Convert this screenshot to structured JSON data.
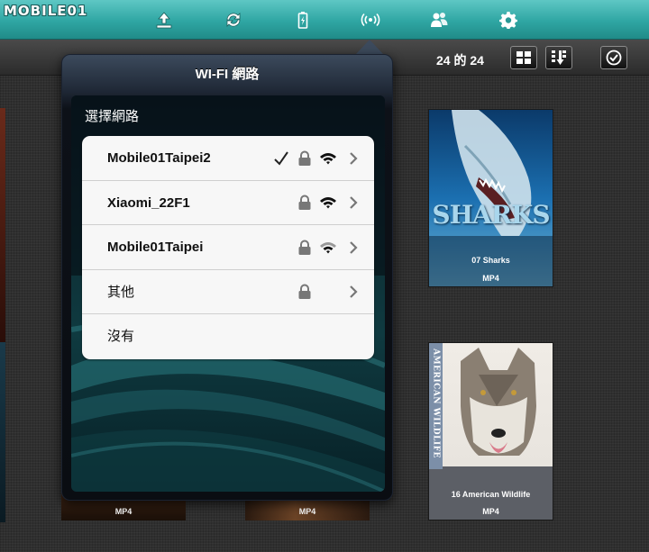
{
  "app": {
    "logo": "MOBILE01"
  },
  "toolbar": {
    "icons": [
      "upload-icon",
      "sync-icon",
      "battery-icon",
      "wifi-broadcast-icon",
      "users-icon",
      "gear-icon"
    ]
  },
  "subbar": {
    "count_text": "24 的 24"
  },
  "wifi_popover": {
    "title": "WI-FI 網路",
    "section_header": "選擇網路",
    "networks": [
      {
        "name": "Mobile01Taipei2",
        "connected": true,
        "locked": true,
        "signal": 3
      },
      {
        "name": "Xiaomi_22F1",
        "connected": false,
        "locked": true,
        "signal": 3
      },
      {
        "name": "Mobile01Taipei",
        "connected": false,
        "locked": true,
        "signal": 2
      },
      {
        "name": "其他",
        "connected": false,
        "locked": true,
        "signal": 0
      },
      {
        "name": "沒有",
        "connected": false,
        "locked": false,
        "signal": 0
      }
    ]
  },
  "media": {
    "sharks": {
      "art_text": "SHARKS",
      "title": "07 Sharks",
      "format": "MP4"
    },
    "wolf": {
      "art_text": "AMERICAN WILDLIFE",
      "title": "16 American Wildlife",
      "format": "MP4"
    },
    "bottom_left_format": "MP4",
    "bottom_mid_format": "MP4"
  },
  "colors": {
    "toolbar_accent": "#2fa6a3",
    "popover_dark": "#0a0d12",
    "list_bg": "#f7f7f7"
  }
}
